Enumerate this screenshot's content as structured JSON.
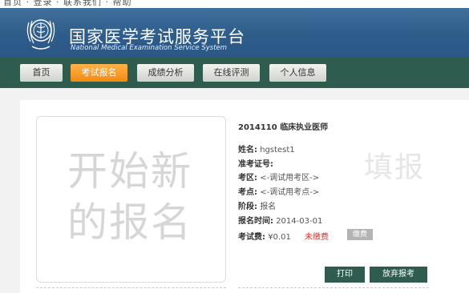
{
  "top_strip": {
    "text": "首页 · 登录 · 联系我们 · 帮助"
  },
  "header": {
    "title_cn": "国家医学考试服务平台",
    "title_en": "National Medical Examination Service System"
  },
  "nav": {
    "items": [
      {
        "label": "首页",
        "active": false
      },
      {
        "label": "考试报名",
        "active": true
      },
      {
        "label": "成绩分析",
        "active": false
      },
      {
        "label": "在线评测",
        "active": false
      },
      {
        "label": "个人信息",
        "active": false
      }
    ]
  },
  "new_registration": {
    "line1": "开始新",
    "line2": "的报名"
  },
  "exam": {
    "title": "2014110 临床执业医师",
    "watermark": "填报",
    "fields": [
      {
        "label": "姓名:",
        "value": "hgstest1"
      },
      {
        "label": "准考证号:",
        "value": ""
      },
      {
        "label": "考区:",
        "value": "<-调试用考区->"
      },
      {
        "label": "考点:",
        "value": "<-调试用考点->"
      },
      {
        "label": "阶段:",
        "value": "报名"
      },
      {
        "label": "报名时间:",
        "value": "2014-03-01"
      },
      {
        "label": "考试费:",
        "value": "¥0.01"
      }
    ],
    "fee_status": "未缴费",
    "pay_label": "缴费",
    "print_label": "打印",
    "cancel_label": "放弃报考"
  },
  "colors": {
    "header": "#2f5d8b",
    "nav": "#2e5c4f",
    "active_tab": "#f18a12",
    "unpaid": "#cc3333"
  }
}
